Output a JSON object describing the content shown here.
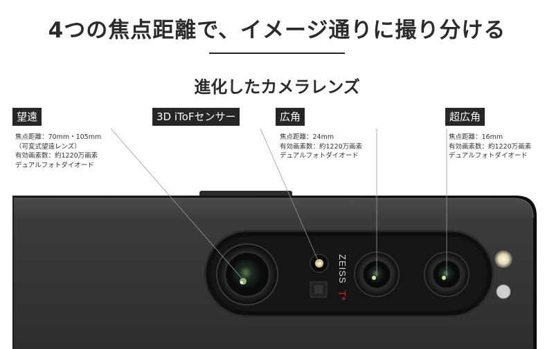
{
  "headline": "4つの焦点距離で、イメージ通りに撮り分ける",
  "subheadline": "進化したカメラレンズ",
  "brand_mark": "ZEISS",
  "brand_t": "T",
  "brand_star": "*",
  "lenses": [
    {
      "name": "望遠",
      "specs": [
        "焦点距離：70mm・105mm",
        "（可変式望遠レンズ）",
        "有効画素数：約1220万画素",
        "デュアルフォトダイオード"
      ]
    },
    {
      "name": "3D iToFセンサー",
      "specs": []
    },
    {
      "name": "広角",
      "specs": [
        "焦点距離：24mm",
        "有効画素数：約1220万画素",
        "デュアルフォトダイオード"
      ]
    },
    {
      "name": "超広角",
      "specs": [
        "焦点距離：16mm",
        "有効画素数：約1220万画素",
        "デュアルフォトダイオード"
      ]
    }
  ],
  "colors": {
    "label_bg": "#262626",
    "phone_body": "#3a3a3a",
    "camera_module": "#111111",
    "zeiss_red": "#d2232a"
  }
}
